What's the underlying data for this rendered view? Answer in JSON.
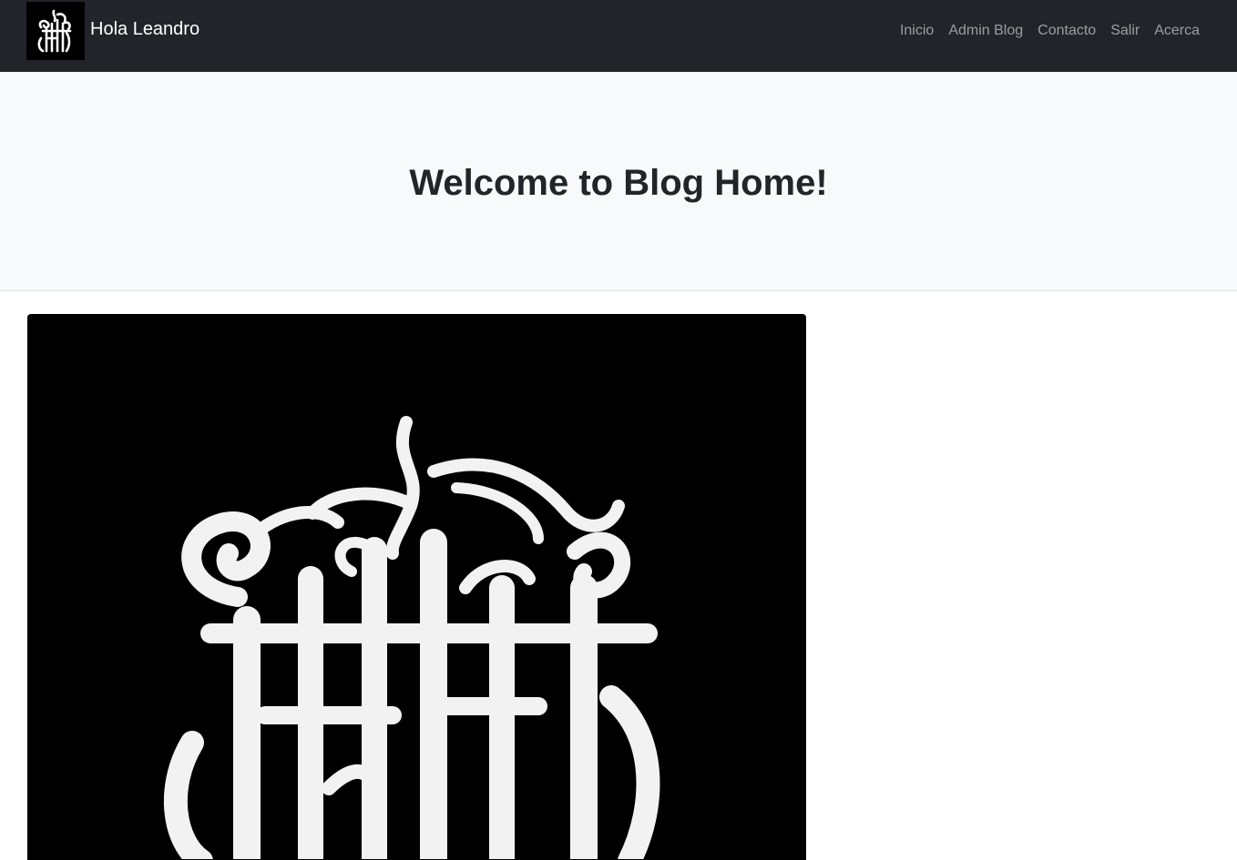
{
  "navbar": {
    "brand_logo_icon": "monogram-logo-icon",
    "brand_text": "Hola Leandro",
    "links": [
      {
        "label": "Inicio"
      },
      {
        "label": "Admin Blog"
      },
      {
        "label": "Contacto"
      },
      {
        "label": "Salir"
      },
      {
        "label": "Acerca"
      }
    ]
  },
  "header": {
    "title": "Welcome to Blog Home!"
  },
  "post": {
    "image_icon": "monogram-logo-image"
  },
  "colors": {
    "navbar_bg": "#212529",
    "header_bg": "#f8f9fa",
    "text": "#212529",
    "nav_link": "#8b8d90"
  }
}
